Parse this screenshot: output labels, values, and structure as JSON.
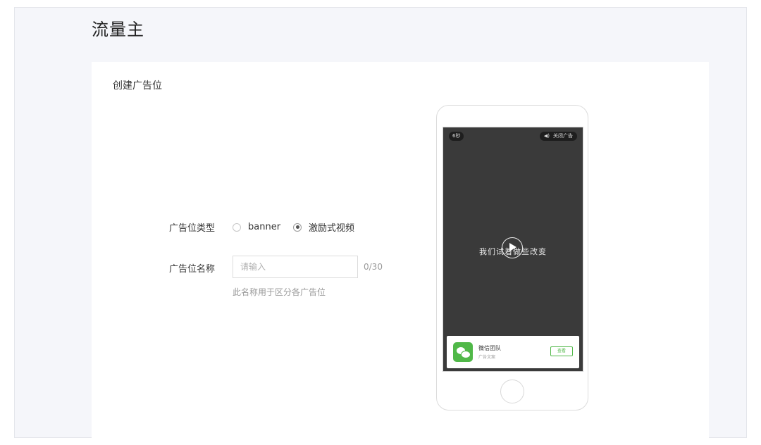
{
  "header": {
    "title": "流量主"
  },
  "card": {
    "title": "创建广告位",
    "type_label": "广告位类型",
    "type_options": [
      {
        "label": "banner",
        "checked": false
      },
      {
        "label": "激励式视频",
        "checked": true
      }
    ],
    "name_label": "广告位名称",
    "name_placeholder": "请输入",
    "name_value": "",
    "name_counter": "0/30",
    "name_hint": "此名称用于区分各广告位"
  },
  "preview": {
    "timer": "6秒",
    "close_ad": "关闭广告",
    "slogan": "我们试着做些改变",
    "ad_name": "微信团队",
    "ad_copy": "广告文案",
    "ad_button": "查看"
  },
  "colors": {
    "accent_green": "#50b848",
    "page_bg": "#f5f6fa",
    "screen_bg": "#3a3a3a"
  },
  "icons": [
    "speaker-icon",
    "play-icon",
    "wechat-icon",
    "home-button-icon"
  ]
}
